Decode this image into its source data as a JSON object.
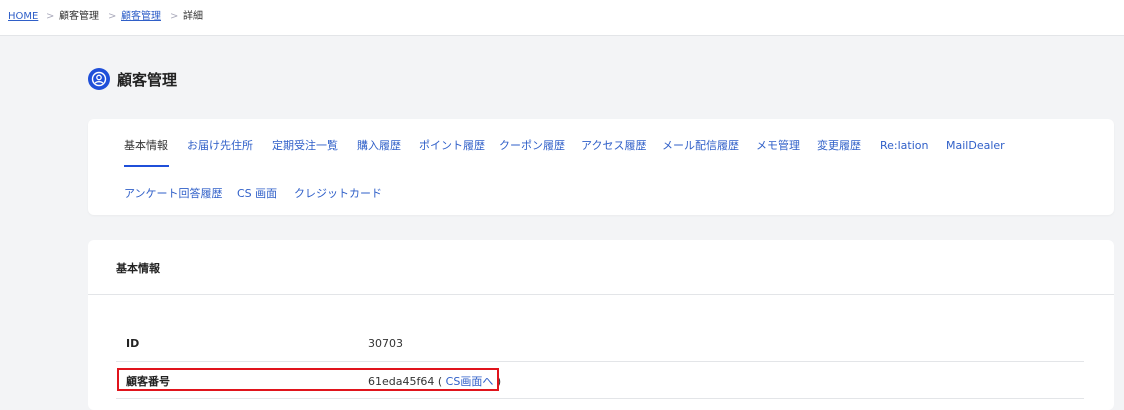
{
  "breadcrumb": {
    "home": "HOME",
    "sep": ">",
    "item1": "顧客管理",
    "item2": "顧客管理",
    "item3": "詳細"
  },
  "page": {
    "title": "顧客管理",
    "icon": "user-circle-icon",
    "accent": "#1f4fd9"
  },
  "tabs": [
    "基本情報",
    "お届け先住所",
    "定期受注一覧",
    "購入履歴",
    "ポイント履歴",
    "クーポン履歴",
    "アクセス履歴",
    "メール配信履歴",
    "メモ管理",
    "変更履歴",
    "Re:lation",
    "MailDealer",
    "アンケート回答履歴",
    "CS 画面",
    "クレジットカード"
  ],
  "active_tab": "基本情報",
  "info": {
    "section_title": "基本情報",
    "id_label": "ID",
    "id_value": "30703",
    "customer_no_label": "顧客番号",
    "customer_no_value": "61eda45f64",
    "open_paren": "(",
    "cs_link": "CS画面へ",
    "close_paren": ")"
  }
}
